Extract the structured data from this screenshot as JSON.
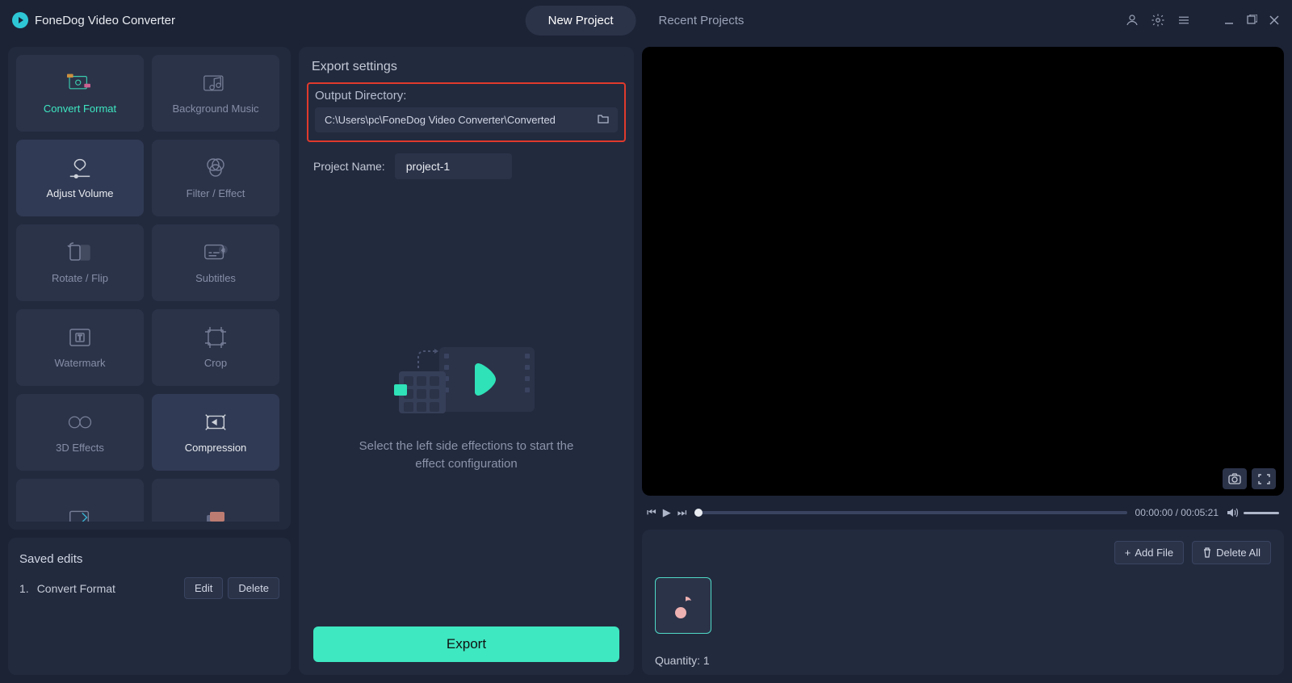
{
  "app_name": "FoneDog Video Converter",
  "tabs": {
    "new": "New Project",
    "recent": "Recent Projects"
  },
  "effects": [
    {
      "id": "convert-format",
      "label": "Convert Format",
      "state": "active"
    },
    {
      "id": "background-music",
      "label": "Background Music",
      "state": ""
    },
    {
      "id": "adjust-volume",
      "label": "Adjust Volume",
      "state": "highlight"
    },
    {
      "id": "filter-effect",
      "label": "Filter / Effect",
      "state": ""
    },
    {
      "id": "rotate-flip",
      "label": "Rotate / Flip",
      "state": ""
    },
    {
      "id": "subtitles",
      "label": "Subtitles",
      "state": ""
    },
    {
      "id": "watermark",
      "label": "Watermark",
      "state": ""
    },
    {
      "id": "crop",
      "label": "Crop",
      "state": ""
    },
    {
      "id": "3d-effects",
      "label": "3D Effects",
      "state": ""
    },
    {
      "id": "compression",
      "label": "Compression",
      "state": "highlight"
    }
  ],
  "saved": {
    "title": "Saved edits",
    "item_number": "1.",
    "item_label": "Convert Format",
    "edit": "Edit",
    "delete": "Delete"
  },
  "export": {
    "section": "Export settings",
    "outdir_label": "Output Directory:",
    "outdir_value": "C:\\Users\\pc\\FoneDog Video Converter\\Converted",
    "project_label": "Project Name:",
    "project_value": "project-1",
    "placeholder_text": "Select the left side effections to start the effect configuration",
    "button": "Export"
  },
  "player": {
    "time_current": "00:00:00",
    "time_total": "00:05:21"
  },
  "filebar": {
    "add": "Add File",
    "delete_all": "Delete All",
    "quantity_label": "Quantity:",
    "quantity_value": "1"
  }
}
